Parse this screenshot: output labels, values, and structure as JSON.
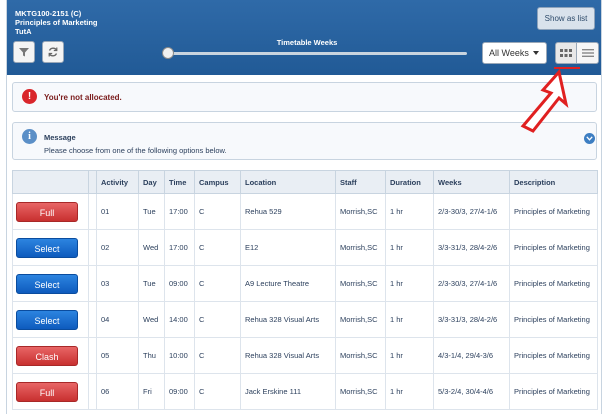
{
  "header": {
    "course_code": "MKTG100-2151 (C)",
    "course_name": "Principles of Marketing",
    "campus_line": "TutA",
    "show_as_list": "Show as list",
    "timetable_label": "Timetable Weeks",
    "weeks_select": "All Weeks",
    "filter_icon": "filter-icon",
    "refresh_icon": "refresh-icon"
  },
  "alert": {
    "text": "You're not allocated.",
    "icon": "!"
  },
  "message": {
    "title": "Message",
    "body": "Please choose from one of the following options below.",
    "icon": "i"
  },
  "table": {
    "headers": [
      "",
      "",
      "Activity",
      "Day",
      "Time",
      "Campus",
      "Location",
      "Staff",
      "Duration",
      "Weeks",
      "Description"
    ],
    "rows": [
      {
        "action": "Full",
        "style": "red",
        "activity": "01",
        "day": "Tue",
        "time": "17:00",
        "campus": "C",
        "location": "Rehua 529",
        "staff": "Morrish,SC",
        "duration": "1 hr",
        "weeks": "2/3-30/3, 27/4-1/6",
        "description": "Principles of Marketing"
      },
      {
        "action": "Select",
        "style": "blue",
        "activity": "02",
        "day": "Wed",
        "time": "17:00",
        "campus": "C",
        "location": "E12",
        "staff": "Morrish,SC",
        "duration": "1 hr",
        "weeks": "3/3-31/3, 28/4-2/6",
        "description": "Principles of Marketing"
      },
      {
        "action": "Select",
        "style": "blue",
        "activity": "03",
        "day": "Tue",
        "time": "09:00",
        "campus": "C",
        "location": "A9 Lecture Theatre",
        "staff": "Morrish,SC",
        "duration": "1 hr",
        "weeks": "2/3-30/3, 27/4-1/6",
        "description": "Principles of Marketing"
      },
      {
        "action": "Select",
        "style": "blue",
        "activity": "04",
        "day": "Wed",
        "time": "14:00",
        "campus": "C",
        "location": "Rehua 328 Visual Arts",
        "staff": "Morrish,SC",
        "duration": "1 hr",
        "weeks": "3/3-31/3, 28/4-2/6",
        "description": "Principles of Marketing"
      },
      {
        "action": "Clash",
        "style": "red",
        "activity": "05",
        "day": "Thu",
        "time": "10:00",
        "campus": "C",
        "location": "Rehua 328 Visual Arts",
        "staff": "Morrish,SC",
        "duration": "1 hr",
        "weeks": "4/3-1/4, 29/4-3/6",
        "description": "Principles of Marketing"
      },
      {
        "action": "Full",
        "style": "red",
        "activity": "06",
        "day": "Fri",
        "time": "09:00",
        "campus": "C",
        "location": "Jack Erskine 111",
        "staff": "Morrish,SC",
        "duration": "1 hr",
        "weeks": "5/3-2/4, 30/4-4/6",
        "description": "Principles of Marketing"
      }
    ]
  },
  "colors": {
    "header_blue": "#215a96",
    "button_red": "#c8302f",
    "button_blue": "#0e5bbd",
    "annotation_red": "#e02020"
  }
}
